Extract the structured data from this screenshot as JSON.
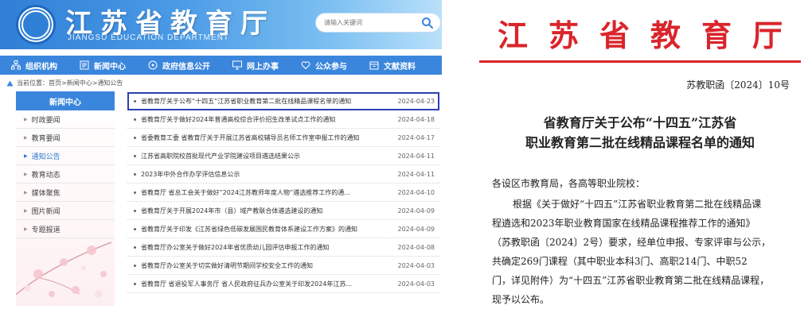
{
  "site": {
    "title": "江苏省教育厅",
    "subtitle": "JIANGSU EDUCATION DEPARTMENT",
    "search_placeholder": "请输入关键词",
    "nav": [
      {
        "label": "组织机构",
        "icon": "org-icon"
      },
      {
        "label": "新闻中心",
        "icon": "news-icon"
      },
      {
        "label": "政府信息公开",
        "icon": "info-icon"
      },
      {
        "label": "网上办事",
        "icon": "monitor-icon"
      },
      {
        "label": "公众参与",
        "icon": "heart-icon"
      },
      {
        "label": "文献资料",
        "icon": "archive-icon"
      }
    ],
    "breadcrumb": "当前位置：首页>新闻中心>通知公告",
    "sidebar": {
      "header": "新闻中心",
      "items": [
        "时政要闻",
        "教育要闻",
        "通知公告",
        "教育动态",
        "媒体聚焦",
        "图片新闻",
        "专题报道"
      ],
      "active_index": 2
    },
    "news": [
      {
        "title": "省教育厅关于公布“十四五”江苏省职业教育第二批在线精品课程名单的通知",
        "date": "2024-04-23"
      },
      {
        "title": "省教育厅关于做好2024年普通高校综合评价招生改革试点工作的通知",
        "date": "2024-04-18"
      },
      {
        "title": "省委教育工委 省教育厅关于开展江苏省高校辅导员名师工作室申报工作的通知",
        "date": "2024-04-17"
      },
      {
        "title": "江苏省高职院校首批现代产业学院建设项目遴选结果公示",
        "date": "2024-04-11"
      },
      {
        "title": "2023年中外合作办学评估信息公示",
        "date": "2024-04-11"
      },
      {
        "title": "省教育厅 省总工会关于做好“2024江苏教师年度人物”遴选推荐工作的通...",
        "date": "2024-04-10"
      },
      {
        "title": "省教育厅关于开展2024年市（县）域产教联合体遴选建设的通知",
        "date": "2024-04-09"
      },
      {
        "title": "省教育厅关于印发《江苏省绿色低碳发展国民教育体系建设工作方案》的通知",
        "date": "2024-04-09"
      },
      {
        "title": "省教育厅办公室关于做好2024年省优质幼儿园评估申报工作的通知",
        "date": "2024-04-08"
      },
      {
        "title": "省教育厅办公室关于切实做好清明节期间学校安全工作的通知",
        "date": "2024-04-03"
      },
      {
        "title": "省教育厅 省退役军人事务厅 省人民政府征兵办公室关于印发2024年江苏...",
        "date": "2024-04-03"
      }
    ],
    "colors": {
      "header_blue": "#2f7fd6",
      "nav_blue": "#3b86dd",
      "highlight_border": "#2d3fb5"
    }
  },
  "doc": {
    "title": "江苏省教育厅",
    "number": "苏教职函〔2024〕10号",
    "heading_line1": "省教育厅关于公布“十四五”江苏省",
    "heading_line2": "职业教育第二批在线精品课程名单的通知",
    "salutation": "各设区市教育局，各高等职业院校：",
    "body_lines": [
      "根据《关于做好“十四五”江苏省职业教育第二批在线精品课",
      "程遴选和2023年职业教育国家在线精品课程推荐工作的通知》",
      "（苏教职函〔2024〕2号）要求，经单位申报、专家评审与公示，",
      "共确定269门课程（其中职业本科3门、高职214门、中职52",
      "门，详见附件）为“十四五”江苏省职业教育第二批在线精品课程，",
      "现予以公布。"
    ],
    "colors": {
      "title_red": "#d9252b"
    }
  }
}
